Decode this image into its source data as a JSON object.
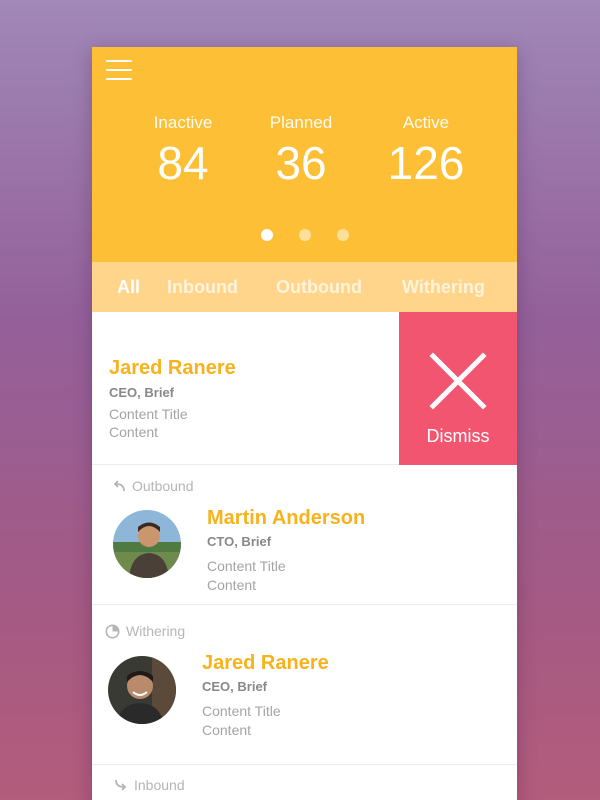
{
  "stats": [
    {
      "label": "Inactive",
      "value": "84"
    },
    {
      "label": "Planned",
      "value": "36"
    },
    {
      "label": "Active",
      "value": "126"
    }
  ],
  "tabs": [
    "All",
    "Inbound",
    "Outbound",
    "Withering"
  ],
  "cards": [
    {
      "name": "Jared Ranere",
      "role": "CEO, Brief",
      "content_title": "Content Title",
      "content": "Content"
    },
    {
      "tag": "Outbound",
      "name": "Martin Anderson",
      "role": "CTO, Brief",
      "content_title": "Content Title",
      "content": "Content"
    },
    {
      "tag": "Withering",
      "name": "Jared Ranere",
      "role": "CEO, Brief",
      "content_title": "Content Title",
      "content": "Content"
    },
    {
      "tag": "Inbound"
    }
  ],
  "dismiss_label": "Dismiss",
  "colors": {
    "header": "#fdbf35",
    "tabs": "#fed58a",
    "accent": "#f7b21c",
    "dismiss": "#f15570"
  }
}
